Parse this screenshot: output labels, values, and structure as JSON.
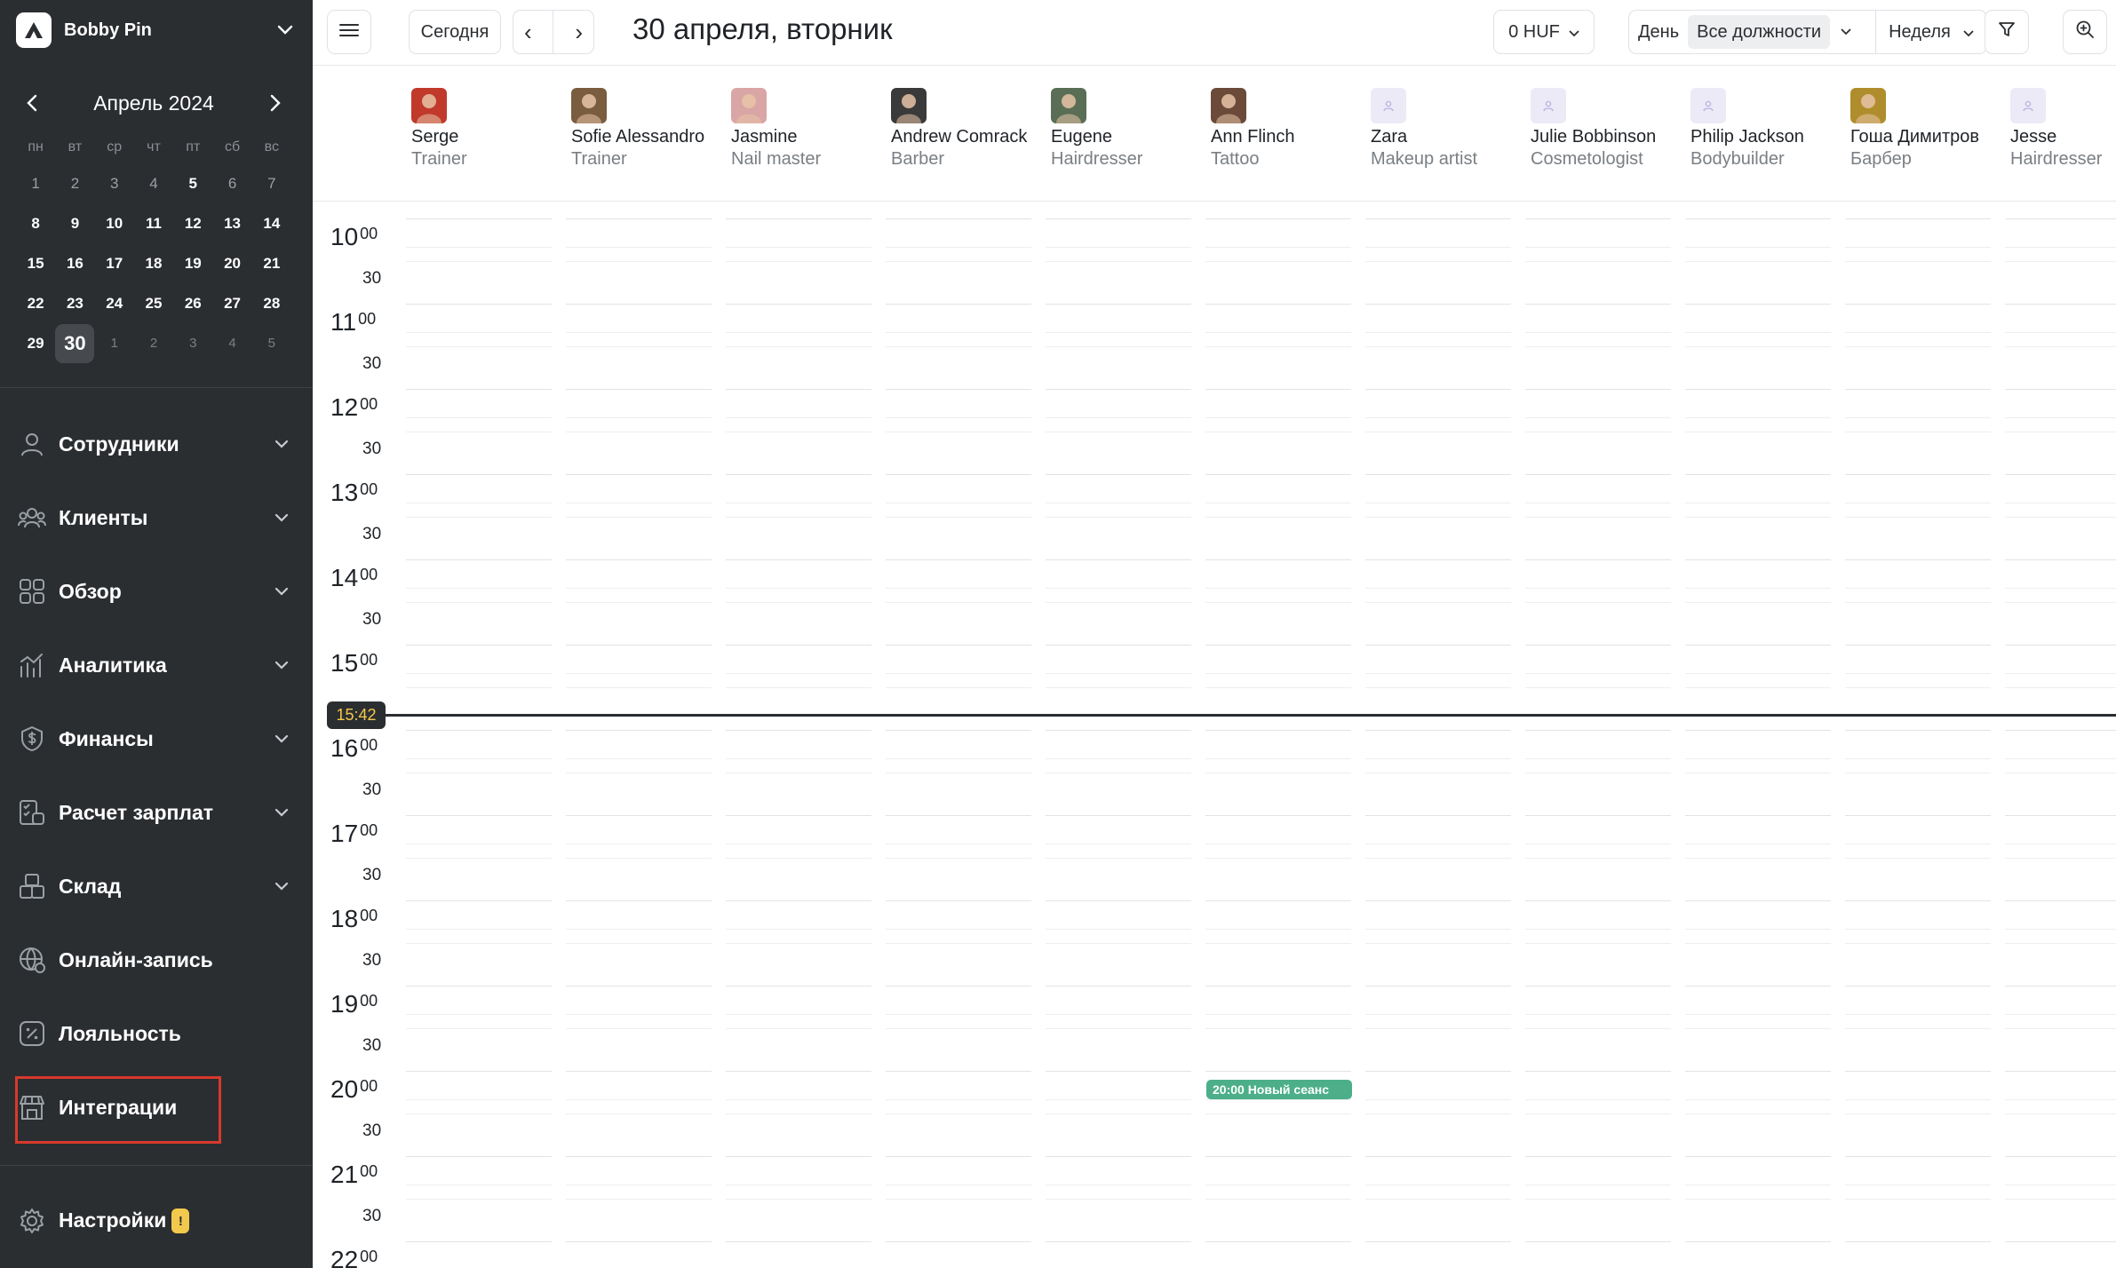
{
  "brand": {
    "name": "Bobby Pin"
  },
  "mini_calendar": {
    "title": "Апрель 2024",
    "weekdays": [
      "пн",
      "вт",
      "ср",
      "чт",
      "пт",
      "сб",
      "вс"
    ],
    "days": [
      {
        "label": "1",
        "state": "past"
      },
      {
        "label": "2",
        "state": "past"
      },
      {
        "label": "3",
        "state": "past"
      },
      {
        "label": "4",
        "state": "past"
      },
      {
        "label": "5",
        "state": "normal"
      },
      {
        "label": "6",
        "state": "past"
      },
      {
        "label": "7",
        "state": "past"
      },
      {
        "label": "8",
        "state": "normal"
      },
      {
        "label": "9",
        "state": "normal"
      },
      {
        "label": "10",
        "state": "normal"
      },
      {
        "label": "11",
        "state": "normal"
      },
      {
        "label": "12",
        "state": "normal"
      },
      {
        "label": "13",
        "state": "normal"
      },
      {
        "label": "14",
        "state": "normal"
      },
      {
        "label": "15",
        "state": "normal"
      },
      {
        "label": "16",
        "state": "normal"
      },
      {
        "label": "17",
        "state": "normal"
      },
      {
        "label": "18",
        "state": "normal"
      },
      {
        "label": "19",
        "state": "normal"
      },
      {
        "label": "20",
        "state": "normal"
      },
      {
        "label": "21",
        "state": "normal"
      },
      {
        "label": "22",
        "state": "normal"
      },
      {
        "label": "23",
        "state": "normal"
      },
      {
        "label": "24",
        "state": "normal"
      },
      {
        "label": "25",
        "state": "normal"
      },
      {
        "label": "26",
        "state": "normal"
      },
      {
        "label": "27",
        "state": "normal"
      },
      {
        "label": "28",
        "state": "normal"
      },
      {
        "label": "29",
        "state": "normal"
      },
      {
        "label": "30",
        "state": "today"
      },
      {
        "label": "1",
        "state": "next"
      },
      {
        "label": "2",
        "state": "next"
      },
      {
        "label": "3",
        "state": "next"
      },
      {
        "label": "4",
        "state": "next"
      },
      {
        "label": "5",
        "state": "next"
      }
    ]
  },
  "nav": [
    {
      "label": "Сотрудники",
      "icon": "user-icon",
      "chevron": true
    },
    {
      "label": "Клиенты",
      "icon": "clients-icon",
      "chevron": true
    },
    {
      "label": "Обзор",
      "icon": "grid-icon",
      "chevron": true
    },
    {
      "label": "Аналитика",
      "icon": "analytics-icon",
      "chevron": true
    },
    {
      "label": "Финансы",
      "icon": "dollar-icon",
      "chevron": true
    },
    {
      "label": "Расчет зарплат",
      "icon": "payroll-icon",
      "chevron": true
    },
    {
      "label": "Склад",
      "icon": "boxes-icon",
      "chevron": true
    },
    {
      "label": "Онлайн-запись",
      "icon": "globe-icon",
      "chevron": false
    },
    {
      "label": "Лояльность",
      "icon": "percent-icon",
      "chevron": false
    },
    {
      "label": "Интеграции",
      "icon": "store-icon",
      "chevron": false,
      "highlighted": true
    }
  ],
  "settings": {
    "label": "Настройки",
    "badge": "!"
  },
  "toolbar": {
    "today": "Сегодня",
    "prev": "‹",
    "next": "›",
    "title": "30 апреля, вторник",
    "currency": "0 HUF",
    "view_day": "День",
    "positions": "Все должности",
    "view_week": "Неделя"
  },
  "staff": [
    {
      "name": "Serge",
      "role": "Trainer",
      "avatar": "photo",
      "color": "#c0392b"
    },
    {
      "name": "Sofie Alessandro",
      "role": "Trainer",
      "avatar": "photo",
      "color": "#7a5c3e"
    },
    {
      "name": "Jasmine",
      "role": "Nail master",
      "avatar": "photo",
      "color": "#d9a5a5"
    },
    {
      "name": "Andrew Comrack",
      "role": "Barber",
      "avatar": "photo",
      "color": "#3a3a3a"
    },
    {
      "name": "Eugene",
      "role": "Hairdresser",
      "avatar": "photo",
      "color": "#5a6e55"
    },
    {
      "name": "Ann Flinch",
      "role": "Tattoo",
      "avatar": "photo",
      "color": "#6b4a3a"
    },
    {
      "name": "Zara",
      "role": "Makeup artist",
      "avatar": "placeholder",
      "color": "#eceaf7"
    },
    {
      "name": "Julie Bobbinson",
      "role": "Cosmetologist",
      "avatar": "placeholder",
      "color": "#eceaf7"
    },
    {
      "name": "Philip Jackson",
      "role": "Bodybuilder",
      "avatar": "placeholder",
      "color": "#eceaf7"
    },
    {
      "name": "Гоша Димитров",
      "role": "Барбер",
      "avatar": "photo",
      "color": "#b08d2c"
    },
    {
      "name": "Jesse",
      "role": "Hairdresser",
      "avatar": "placeholder",
      "color": "#eceaf7"
    }
  ],
  "time_slots": [
    {
      "hour": "10",
      "min": "00",
      "half": "30"
    },
    {
      "hour": "11",
      "min": "00",
      "half": "30"
    },
    {
      "hour": "12",
      "min": "00",
      "half": "30"
    },
    {
      "hour": "13",
      "min": "00",
      "half": "30"
    },
    {
      "hour": "14",
      "min": "00",
      "half": "30"
    },
    {
      "hour": "15",
      "min": "00",
      "half": ""
    },
    {
      "hour": "16",
      "min": "00",
      "half": "30"
    },
    {
      "hour": "17",
      "min": "00",
      "half": "30"
    },
    {
      "hour": "18",
      "min": "00",
      "half": "30"
    },
    {
      "hour": "19",
      "min": "00",
      "half": "30"
    },
    {
      "hour": "20",
      "min": "00",
      "half": "30"
    },
    {
      "hour": "21",
      "min": "00",
      "half": "30"
    },
    {
      "hour": "22",
      "min": "00",
      "half": ""
    }
  ],
  "now": {
    "time": "15:42"
  },
  "event": {
    "label": "20:00 Новый сеанс",
    "staff": "Ann Flinch",
    "color": "#4caf8a"
  }
}
